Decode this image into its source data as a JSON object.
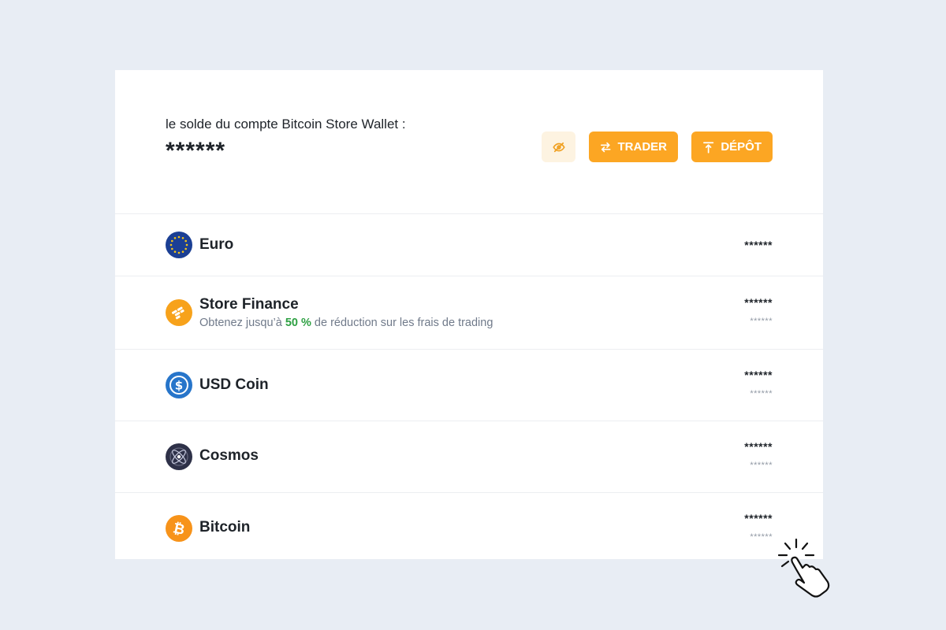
{
  "balance": {
    "label": "le solde du compte Bitcoin Store Wallet :",
    "value": "******"
  },
  "actions": {
    "toggle_visibility_icon": "eye-off-icon",
    "trader_label": "TRADER",
    "trader_icon": "swap-arrows-icon",
    "depot_label": "DÉPÔT",
    "depot_icon": "upload-icon"
  },
  "assets": [
    {
      "name": "Euro",
      "icon": "euro-flag-icon",
      "amount": "******"
    },
    {
      "name": "Store Finance",
      "icon": "store-finance-icon",
      "subtitle_pre": "Obtenez jusqu’à ",
      "subtitle_highlight": "50 %",
      "subtitle_post": " de réduction sur les frais de trading",
      "amount": "******",
      "amount_sub": "******"
    },
    {
      "name": "USD Coin",
      "icon": "usd-coin-icon",
      "amount": "******",
      "amount_sub": "******"
    },
    {
      "name": "Cosmos",
      "icon": "cosmos-icon",
      "amount": "******",
      "amount_sub": "******"
    },
    {
      "name": "Bitcoin",
      "icon": "bitcoin-icon",
      "amount": "******",
      "amount_sub": "******"
    }
  ],
  "colors": {
    "accent": "#fca623",
    "accent_light": "#fdf3e1",
    "highlight_green": "#2ea043",
    "background": "#e8edf4"
  }
}
